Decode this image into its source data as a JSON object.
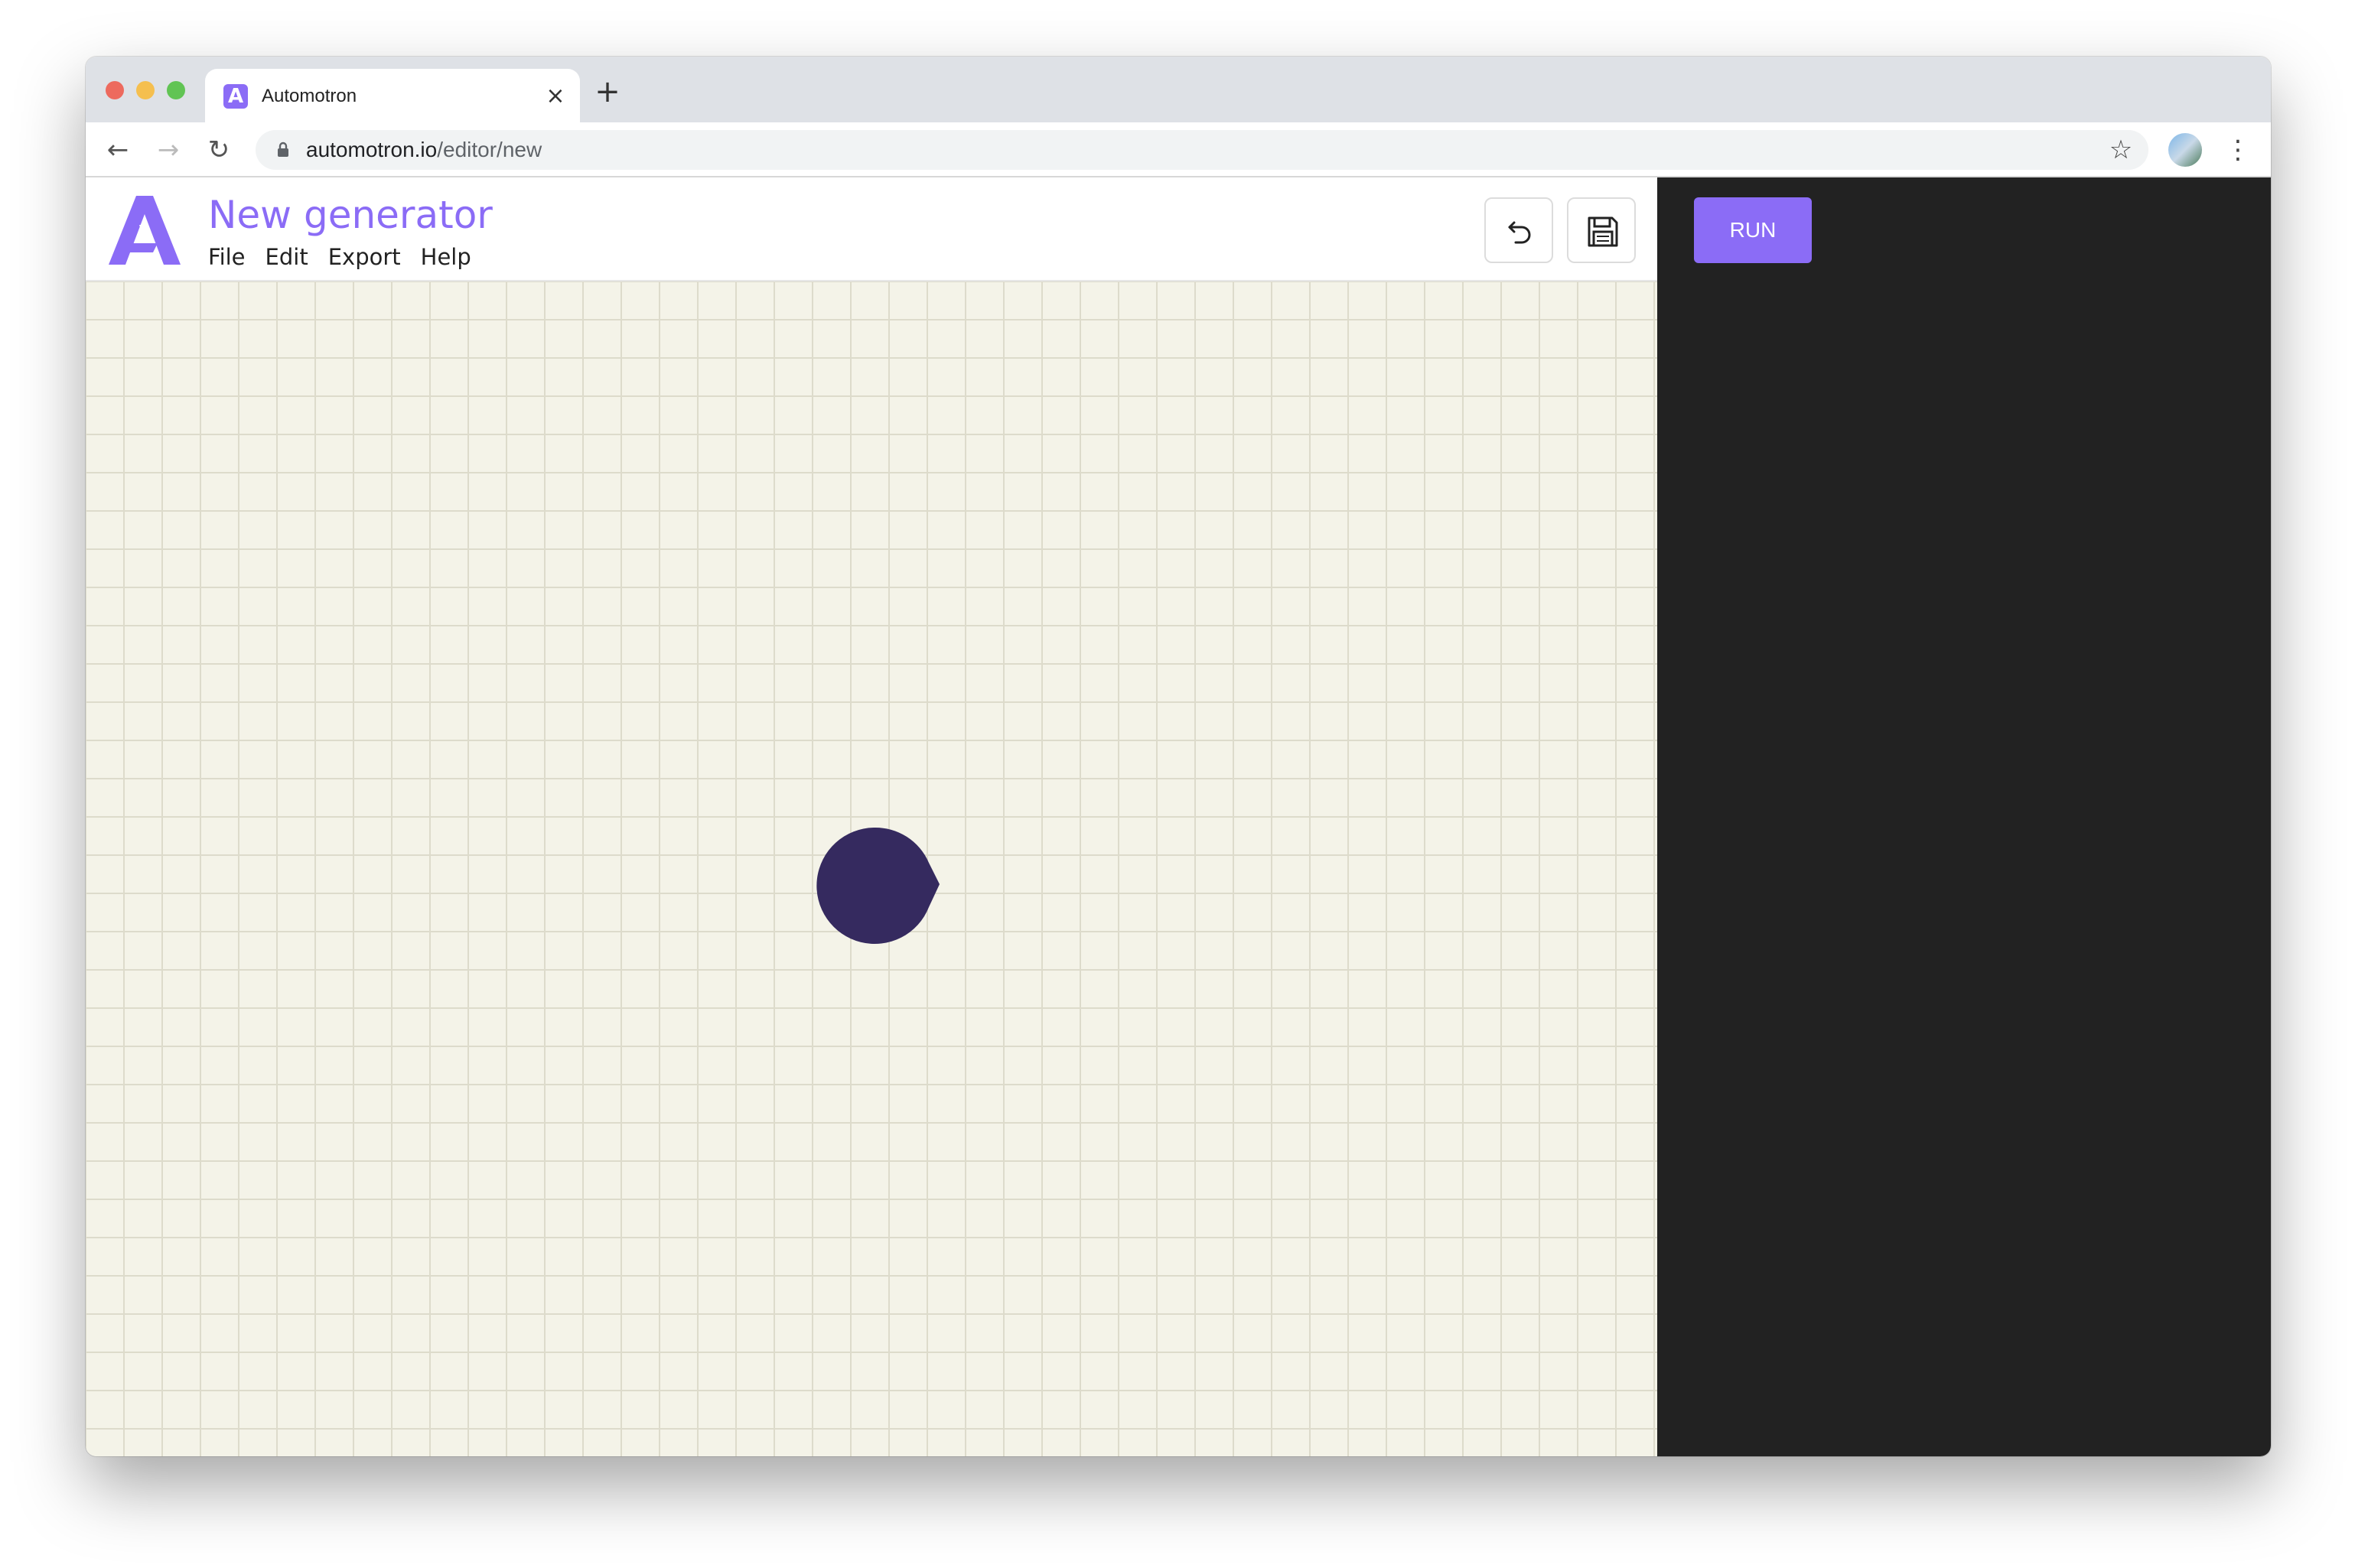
{
  "browser": {
    "tab": {
      "title": "Automotron",
      "favicon": "A",
      "close_icon": "×"
    },
    "new_tab_icon": "+",
    "nav": {
      "back_icon": "←",
      "forward_icon": "→",
      "reload_icon": "↻"
    },
    "address": {
      "host": "automotron.io",
      "path": "/editor/new"
    },
    "bookmark_icon": "☆",
    "menu_icon": "⋮"
  },
  "app": {
    "document_title": "New generator",
    "menu": [
      "File",
      "Edit",
      "Export",
      "Help"
    ],
    "tools": {
      "undo": "undo-icon",
      "save": "floppy-disk-icon"
    },
    "run_label": "RUN",
    "colors": {
      "accent": "#8b6cf6",
      "canvas": "#f4f3e8",
      "grid": "#dddbcb",
      "node": "#352a5f",
      "panel": "#222222"
    }
  }
}
